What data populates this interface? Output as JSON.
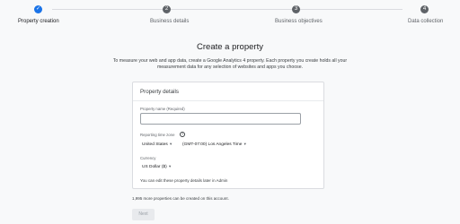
{
  "stepper": {
    "steps": [
      {
        "number": "✓",
        "label": "Property creation",
        "state": "done"
      },
      {
        "number": "2",
        "label": "Business details",
        "state": "pending"
      },
      {
        "number": "3",
        "label": "Business objectives",
        "state": "pending"
      },
      {
        "number": "4",
        "label": "Data collection",
        "state": "pending"
      }
    ],
    "active_color": "#1a73e8"
  },
  "page": {
    "title": "Create a property",
    "intro": "To measure your web and app data, create a Google Analytics 4 property. Each property you create holds all your measurement data for any selection of websites and apps you choose."
  },
  "card": {
    "title": "Property details",
    "name_label": "Property name (Required)",
    "name_value": "",
    "timezone_label": "Reporting time zone",
    "help_icon": "help-circle-icon",
    "country": "United States",
    "timezone": "(GMT-07:00) Los Angeles Time",
    "currency_label": "Currency",
    "currency": "US Dollar ($)",
    "note": "You can edit these property details later in Admin"
  },
  "footer": {
    "quota": "1,995 more properties can be created on this account.",
    "next_label": "Next"
  }
}
